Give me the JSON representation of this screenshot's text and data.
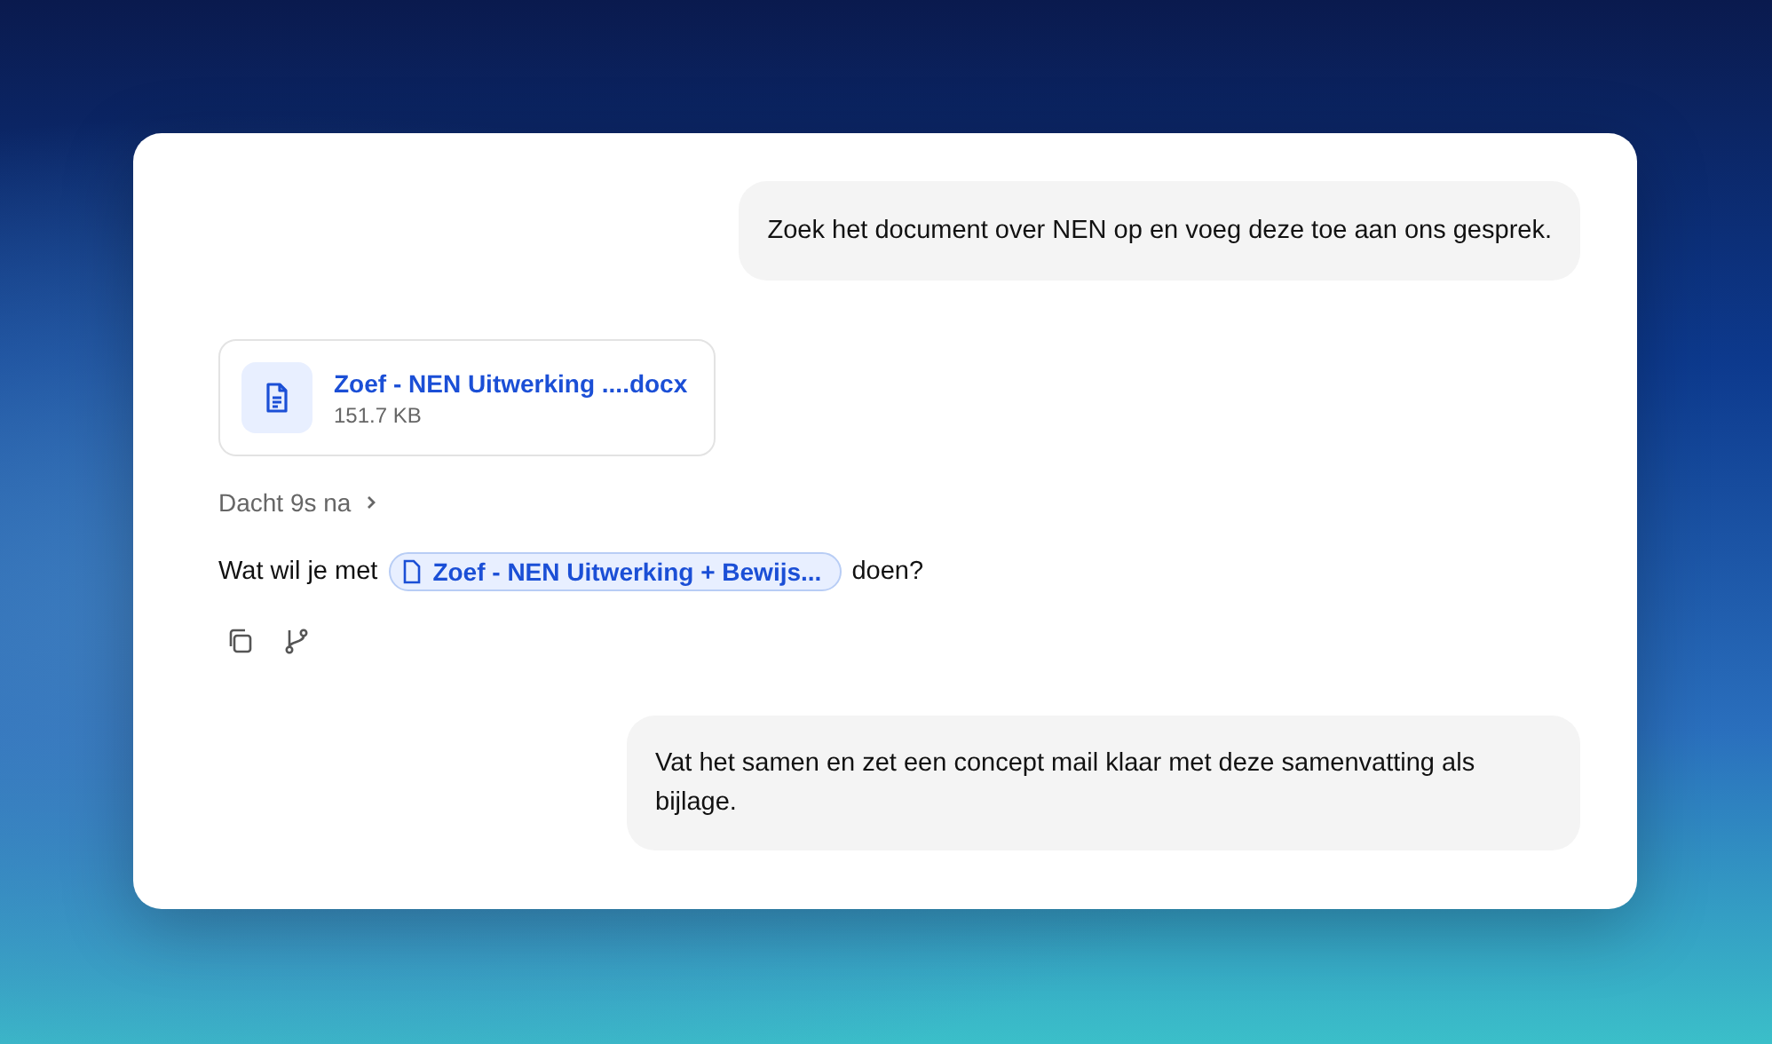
{
  "messages": [
    {
      "kind": "user",
      "text": "Zoek het document over NEN op en voeg deze toe aan ons gesprek."
    },
    {
      "kind": "file",
      "name": "Zoef - NEN Uitwerking ....docx",
      "size": "151.7 KB"
    },
    {
      "kind": "thinking",
      "text": "Dacht 9s na",
      "expanded": false
    },
    {
      "kind": "assistant",
      "before": "Wat wil je met",
      "chip": "Zoef - NEN Uitwerking + Bewijs...",
      "after": "doen?"
    },
    {
      "kind": "actions"
    },
    {
      "kind": "user",
      "text": "Vat het samen en zet een concept mail klaar met deze samenvatting als bijlage."
    }
  ]
}
